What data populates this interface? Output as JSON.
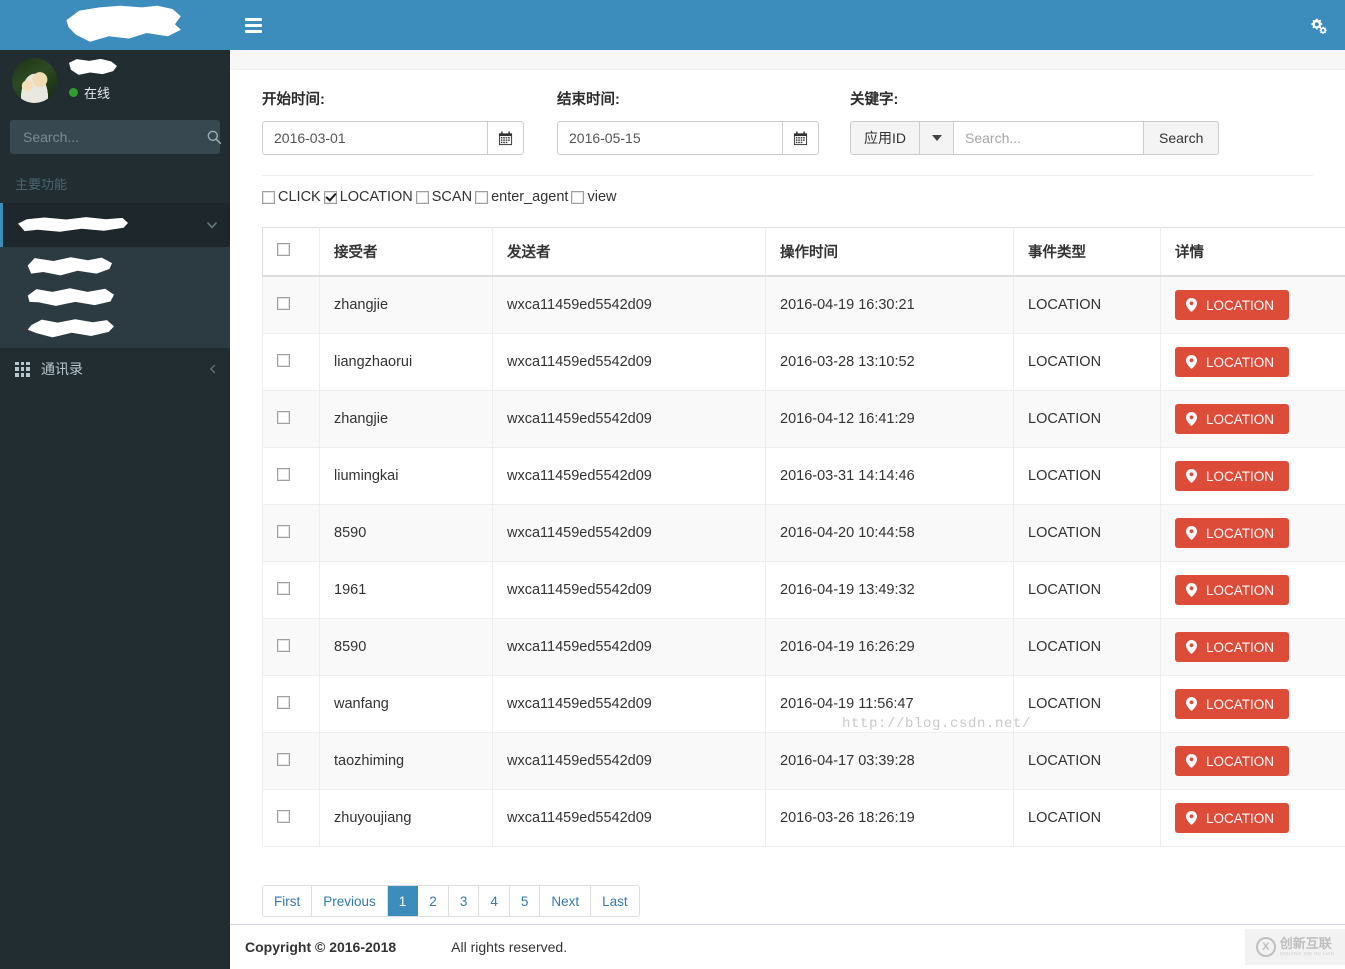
{
  "colors": {
    "brand_blue": "#3c8dbc",
    "sidebar_dark": "#222d32",
    "danger_red": "#dd4b39",
    "online_green": "#2f9e2f"
  },
  "sidebar": {
    "logo_alt": "redacted-logo",
    "user": {
      "name": "",
      "status_label": "在线"
    },
    "search": {
      "placeholder": "Search...",
      "value": ""
    },
    "section_header": "主要功能",
    "menu_items": [
      {
        "label": "",
        "redacted": true,
        "expanded": true
      },
      {
        "label": "",
        "redacted": true
      },
      {
        "label": "",
        "redacted": true
      },
      {
        "label": "",
        "redacted": true
      }
    ],
    "contacts_item": {
      "label": "通讯录"
    }
  },
  "topbar": {
    "menu_toggle": "hamburger",
    "settings_icon": "cogs-icon"
  },
  "filters": {
    "start_time": {
      "label": "开始时间:",
      "value": "2016-03-01"
    },
    "end_time": {
      "label": "结束时间:",
      "value": "2016-05-15"
    },
    "keyword": {
      "label": "关键字:",
      "prefix": "应用ID",
      "placeholder": "Search...",
      "value": "",
      "button": "Search"
    }
  },
  "event_types": [
    {
      "label": "CLICK",
      "checked": false
    },
    {
      "label": "LOCATION",
      "checked": true
    },
    {
      "label": "SCAN",
      "checked": false
    },
    {
      "label": "enter_agent",
      "checked": false
    },
    {
      "label": "view",
      "checked": false
    }
  ],
  "table": {
    "columns": [
      "",
      "接受者",
      "发送者",
      "操作时间",
      "事件类型",
      "详情"
    ],
    "rows": [
      {
        "receiver": "zhangjie",
        "sender": "wxca11459ed5542d09",
        "time": "2016-04-19 16:30:21",
        "type": "LOCATION",
        "action": "LOCATION"
      },
      {
        "receiver": "liangzhaorui",
        "sender": "wxca11459ed5542d09",
        "time": "2016-03-28 13:10:52",
        "type": "LOCATION",
        "action": "LOCATION"
      },
      {
        "receiver": "zhangjie",
        "sender": "wxca11459ed5542d09",
        "time": "2016-04-12 16:41:29",
        "type": "LOCATION",
        "action": "LOCATION"
      },
      {
        "receiver": "liumingkai",
        "sender": "wxca11459ed5542d09",
        "time": "2016-03-31 14:14:46",
        "type": "LOCATION",
        "action": "LOCATION"
      },
      {
        "receiver": "8590",
        "sender": "wxca11459ed5542d09",
        "time": "2016-04-20 10:44:58",
        "type": "LOCATION",
        "action": "LOCATION"
      },
      {
        "receiver": "1961",
        "sender": "wxca11459ed5542d09",
        "time": "2016-04-19 13:49:32",
        "type": "LOCATION",
        "action": "LOCATION"
      },
      {
        "receiver": "8590",
        "sender": "wxca11459ed5542d09",
        "time": "2016-04-19 16:26:29",
        "type": "LOCATION",
        "action": "LOCATION"
      },
      {
        "receiver": "wanfang",
        "sender": "wxca11459ed5542d09",
        "time": "2016-04-19 11:56:47",
        "type": "LOCATION",
        "action": "LOCATION"
      },
      {
        "receiver": "taozhiming",
        "sender": "wxca11459ed5542d09",
        "time": "2016-04-17 03:39:28",
        "type": "LOCATION",
        "action": "LOCATION"
      },
      {
        "receiver": "zhuyoujiang",
        "sender": "wxca11459ed5542d09",
        "time": "2016-03-26 18:26:19",
        "type": "LOCATION",
        "action": "LOCATION"
      }
    ]
  },
  "watermark": "http://blog.csdn.net/",
  "pagination": {
    "items": [
      "First",
      "Previous",
      "1",
      "2",
      "3",
      "4",
      "5",
      "Next",
      "Last"
    ],
    "active": "1"
  },
  "footer": {
    "copyright": "Copyright © 2016-2018",
    "rights": "All rights reserved.",
    "brand_mark": "X",
    "brand_cn": "创新互联",
    "brand_py": "CHUANG XIN HU LIAN"
  }
}
